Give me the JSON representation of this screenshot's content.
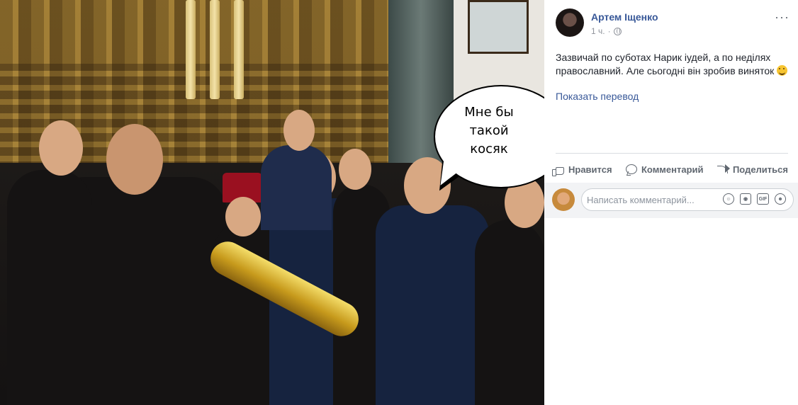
{
  "photo": {
    "speech_bubble_text": "Мне бы\nтакой\nкосяк"
  },
  "post": {
    "author": "Артем Іщенко",
    "time": "1 ч.",
    "privacy_icon": "globe-icon",
    "more_icon": "ellipsis-icon",
    "more_glyph": "···",
    "text": "Зазвичай по суботах Нарик іудей, а по неділях православний. Але сьогодні він зробив виняток",
    "emoji": "smiling-face-emoji",
    "translate_link": "Показать перевод"
  },
  "actions": {
    "like": "Нравится",
    "comment": "Комментарий",
    "share": "Поделиться"
  },
  "comment_box": {
    "placeholder": "Написать комментарий...",
    "icons": [
      "emoji-icon",
      "camera-icon",
      "gif-icon",
      "sticker-icon"
    ],
    "gif_label": "GIF"
  },
  "colors": {
    "link_blue": "#385898",
    "text": "#1d2129",
    "muted": "#90949c"
  }
}
